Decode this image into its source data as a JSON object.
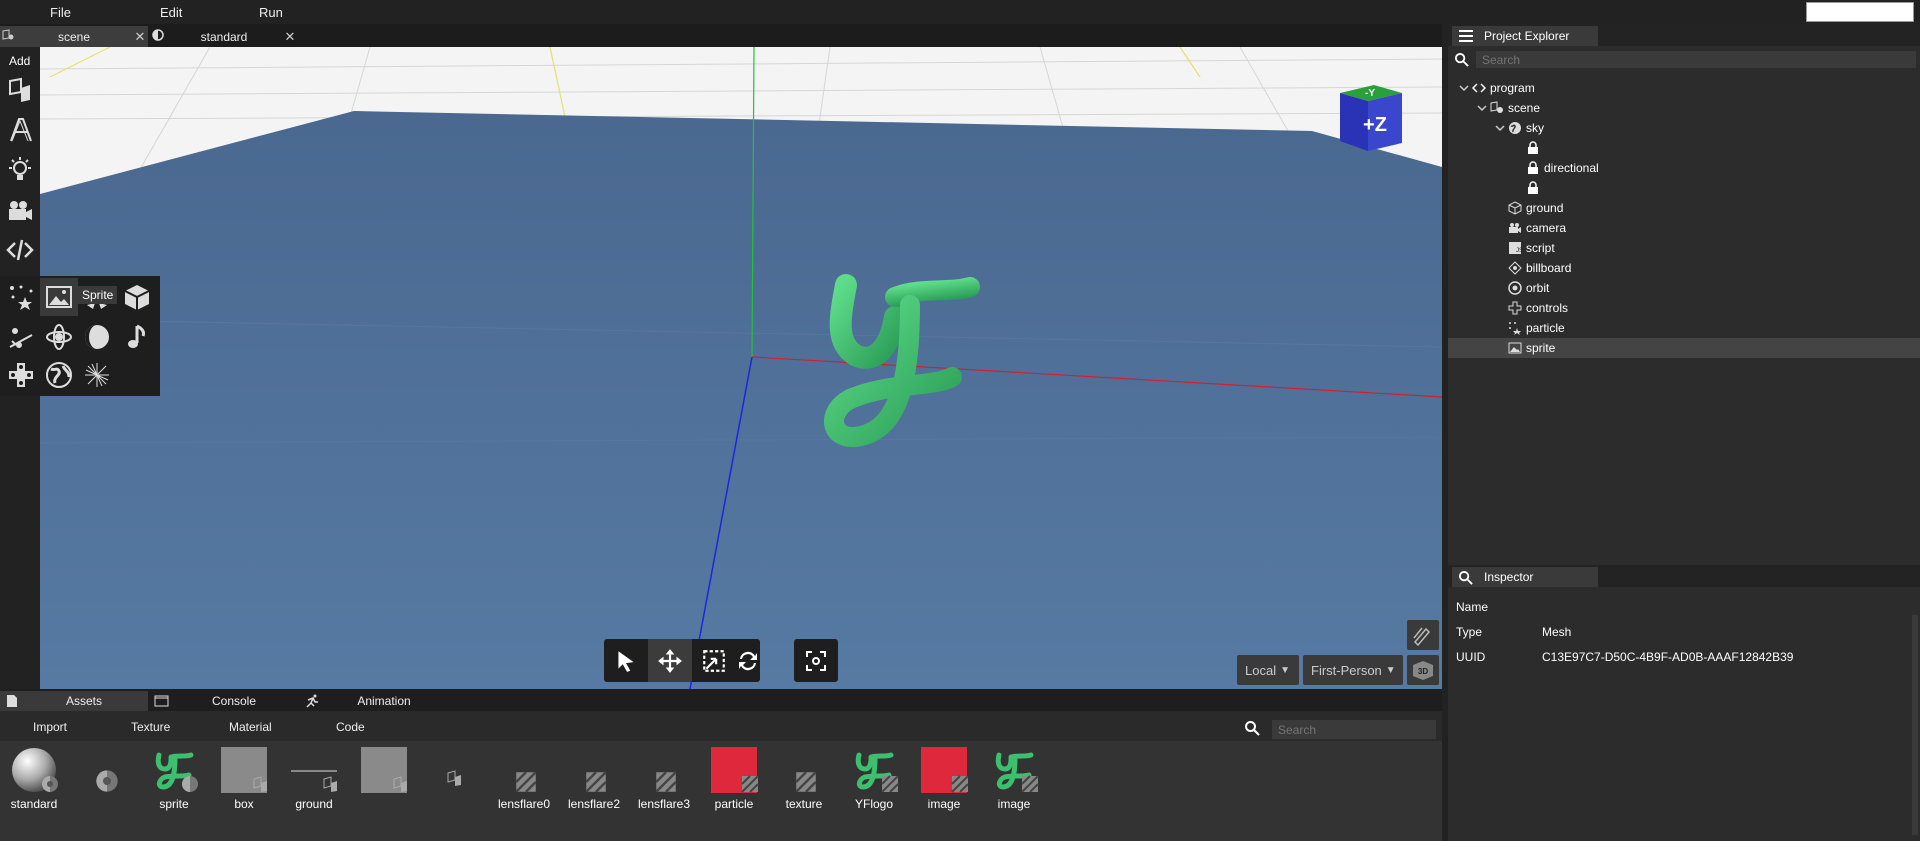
{
  "menubar": {
    "items": [
      "File",
      "Edit",
      "Run"
    ]
  },
  "tabs": [
    {
      "label": "scene",
      "active": true,
      "icon": "scene-icon"
    },
    {
      "label": "standard",
      "active": false,
      "icon": "material-icon"
    }
  ],
  "toolbar": {
    "add_label": "Add",
    "tools": [
      "box-icon",
      "text-icon",
      "light-icon",
      "camera-icon",
      "code-icon",
      "particles-icon",
      "joint-icon",
      "puzzle-icon"
    ]
  },
  "popup": {
    "items": [
      "particles-icon",
      "image-icon",
      "billboard-icon",
      "cube-icon",
      "physics-icon",
      "orbit-icon",
      "moon-icon",
      "music-icon",
      "controls-icon",
      "sky-icon",
      "lensflare-icon"
    ],
    "tooltip": "Sprite"
  },
  "viewport": {
    "cube_top": "-Y",
    "cube_front": "+Z",
    "space_select": "Local",
    "camera_select": "First-Person"
  },
  "bottom_tabs": [
    "Assets",
    "Console",
    "Animation"
  ],
  "asset_subtabs": [
    "Import",
    "Texture",
    "Material",
    "Code"
  ],
  "asset_search_placeholder": "Search",
  "assets": [
    {
      "name": "standard",
      "kind": "sphere"
    },
    {
      "name": "",
      "kind": "material"
    },
    {
      "name": "sprite",
      "kind": "yflogo"
    },
    {
      "name": "box",
      "kind": "gray"
    },
    {
      "name": "ground",
      "kind": "line"
    },
    {
      "name": "",
      "kind": "gray"
    },
    {
      "name": "",
      "kind": "empty"
    },
    {
      "name": "lensflare0",
      "kind": "texture"
    },
    {
      "name": "lensflare2",
      "kind": "texture"
    },
    {
      "name": "lensflare3",
      "kind": "texture"
    },
    {
      "name": "particle",
      "kind": "red"
    },
    {
      "name": "texture",
      "kind": "texture"
    },
    {
      "name": "YFlogo",
      "kind": "yflogo"
    },
    {
      "name": "image",
      "kind": "red"
    },
    {
      "name": "image",
      "kind": "yflogo"
    }
  ],
  "explorer": {
    "title": "Project Explorer",
    "search_placeholder": "Search",
    "tree": [
      {
        "label": "program",
        "depth": 0,
        "icon": "code-icon",
        "arrow": true
      },
      {
        "label": "scene",
        "depth": 1,
        "icon": "scene-icon",
        "arrow": true
      },
      {
        "label": "sky",
        "depth": 2,
        "icon": "sky-icon",
        "arrow": true
      },
      {
        "label": "",
        "depth": 3,
        "icon": "lock-icon",
        "arrow": false
      },
      {
        "label": "directional",
        "depth": 3,
        "icon": "lock-icon",
        "arrow": false
      },
      {
        "label": "",
        "depth": 3,
        "icon": "lock-icon",
        "arrow": false
      },
      {
        "label": "ground",
        "depth": 2,
        "icon": "cube-icon",
        "arrow": false
      },
      {
        "label": "camera",
        "depth": 2,
        "icon": "camera-icon",
        "arrow": false
      },
      {
        "label": "script",
        "depth": 2,
        "icon": "script-icon",
        "arrow": false
      },
      {
        "label": "billboard",
        "depth": 2,
        "icon": "billboard-icon",
        "arrow": false
      },
      {
        "label": "orbit",
        "depth": 2,
        "icon": "orbit-icon",
        "arrow": false
      },
      {
        "label": "controls",
        "depth": 2,
        "icon": "controls-icon",
        "arrow": false
      },
      {
        "label": "particle",
        "depth": 2,
        "icon": "particles-icon",
        "arrow": false
      },
      {
        "label": "sprite",
        "depth": 2,
        "icon": "image-icon",
        "arrow": false,
        "selected": true
      }
    ]
  },
  "inspector": {
    "title": "Inspector",
    "rows": [
      {
        "key": "Name",
        "value": ""
      },
      {
        "key": "Type",
        "value": "Mesh"
      },
      {
        "key": "UUID",
        "value": "C13E97C7-D50C-4B9F-AD0B-AAAF12842B39"
      }
    ]
  },
  "colors": {
    "ground": "#4a6a90",
    "logo": "#3cbf6e",
    "accent_red": "#e0283c",
    "cube_top": "#2a9d3a",
    "cube_front": "#2a32b5"
  }
}
